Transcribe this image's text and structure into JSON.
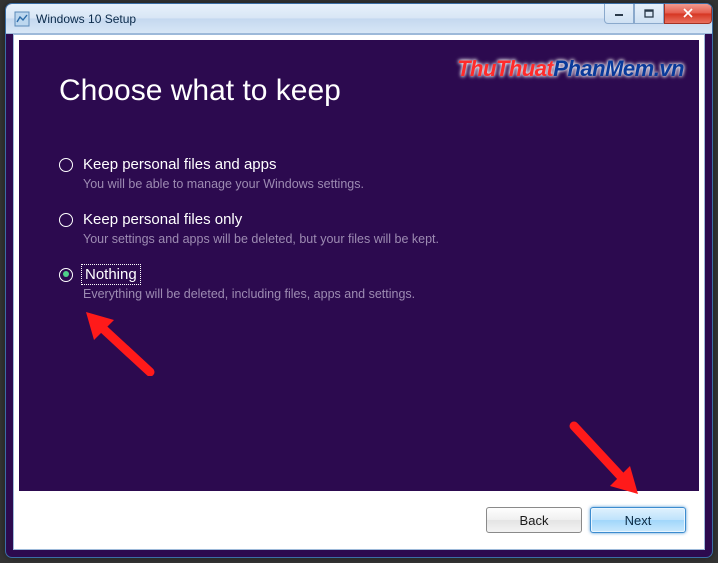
{
  "window_title": "Windows 10 Setup",
  "heading": "Choose what to keep",
  "options": [
    {
      "label": "Keep personal files and apps",
      "desc": "You will be able to manage your Windows settings.",
      "selected": false,
      "focused": false
    },
    {
      "label": "Keep personal files only",
      "desc": "Your settings and apps will be deleted, but your files will be kept.",
      "selected": false,
      "focused": false
    },
    {
      "label": "Nothing",
      "desc": "Everything will be deleted, including files, apps and settings.",
      "selected": true,
      "focused": true
    }
  ],
  "buttons": {
    "back": "Back",
    "next": "Next"
  },
  "watermark": {
    "part1": "ThuThuat",
    "part2": "PhanMem.vn"
  }
}
